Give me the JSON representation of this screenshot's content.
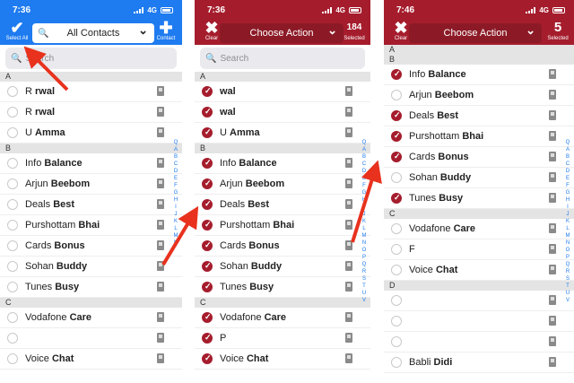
{
  "colors": {
    "blue": "#1e7bf0",
    "red": "#a51d2d",
    "redDark": "#8c1a26"
  },
  "panels": [
    {
      "id": "p1",
      "time": "7:36",
      "network": "4G",
      "left_glyph": "✔",
      "left_caption": "Select All",
      "center_label": "All Contacts",
      "right_glyph": "✚",
      "right_caption": "Contact",
      "search_placeholder": "Search",
      "index_letters": [
        "Q",
        "A",
        "B",
        "C",
        "D",
        "E",
        "F",
        "G",
        "H",
        "I",
        "J",
        "K",
        "L",
        "M",
        "N"
      ],
      "sections": [
        {
          "letter": "A",
          "rows": [
            {
              "first": "R",
              "last": "rwal",
              "checked": false,
              "icon": "phone"
            },
            {
              "first": "R",
              "last": "rwal",
              "checked": false,
              "icon": "phone"
            },
            {
              "first": "U",
              "last": "Amma",
              "checked": false,
              "icon": "phone"
            }
          ]
        },
        {
          "letter": "B",
          "rows": [
            {
              "first": "Info",
              "last": "Balance",
              "checked": false,
              "icon": "phone"
            },
            {
              "first": "Arjun",
              "last": "Beebom",
              "checked": false,
              "icon": "phone"
            },
            {
              "first": "Deals",
              "last": "Best",
              "checked": false,
              "icon": "phone"
            },
            {
              "first": "Purshottam",
              "last": "Bhai",
              "checked": false,
              "icon": "phone"
            },
            {
              "first": "Cards",
              "last": "Bonus",
              "checked": false,
              "icon": "phone"
            },
            {
              "first": "Sohan",
              "last": "Buddy",
              "checked": false,
              "icon": "phone"
            },
            {
              "first": "Tunes",
              "last": "Busy",
              "checked": false,
              "icon": "phone"
            }
          ]
        },
        {
          "letter": "C",
          "rows": [
            {
              "first": "Vodafone",
              "last": "Care",
              "checked": false,
              "icon": "phone"
            },
            {
              "first": "",
              "last": "",
              "checked": false,
              "icon": "phone"
            },
            {
              "first": "Voice",
              "last": "Chat",
              "checked": false,
              "icon": "phone"
            }
          ]
        }
      ]
    },
    {
      "id": "p2",
      "time": "7:36",
      "network": "4G",
      "left_glyph": "✖",
      "left_caption": "Clear",
      "center_label": "Choose Action",
      "right_glyph": "184",
      "right_caption": "Selected",
      "search_placeholder": "Search",
      "index_letters": [
        "Q",
        "A",
        "B",
        "C",
        "D",
        "E",
        "F",
        "G",
        "H",
        "I",
        "J",
        "K",
        "L",
        "M",
        "N",
        "O",
        "P",
        "Q",
        "R",
        "S",
        "T",
        "U",
        "V"
      ],
      "sections": [
        {
          "letter": "A",
          "rows": [
            {
              "first": "",
              "last": "wal",
              "checked": true,
              "icon": "phone"
            },
            {
              "first": "",
              "last": "wal",
              "checked": true,
              "icon": "phone"
            },
            {
              "first": "U",
              "last": "Amma",
              "checked": true,
              "icon": "phone"
            }
          ]
        },
        {
          "letter": "B",
          "rows": [
            {
              "first": "Info",
              "last": "Balance",
              "checked": true,
              "icon": "phone"
            },
            {
              "first": "Arjun",
              "last": "Beebom",
              "checked": true,
              "icon": "phone"
            },
            {
              "first": "Deals",
              "last": "Best",
              "checked": true,
              "icon": "phone"
            },
            {
              "first": "Purshottam",
              "last": "Bhai",
              "checked": true,
              "icon": "phone"
            },
            {
              "first": "Cards",
              "last": "Bonus",
              "checked": true,
              "icon": "phone"
            },
            {
              "first": "Sohan",
              "last": "Buddy",
              "checked": true,
              "icon": "phone"
            },
            {
              "first": "Tunes",
              "last": "Busy",
              "checked": true,
              "icon": "phone"
            }
          ]
        },
        {
          "letter": "C",
          "rows": [
            {
              "first": "Vodafone",
              "last": "Care",
              "checked": true,
              "icon": "phone"
            },
            {
              "first": "P",
              "last": "",
              "checked": true,
              "icon": "phone"
            },
            {
              "first": "Voice",
              "last": "Chat",
              "checked": true,
              "icon": "phone"
            }
          ]
        }
      ]
    },
    {
      "id": "p3",
      "time": "7:46",
      "network": "4G",
      "left_glyph": "✖",
      "left_caption": "Clear",
      "center_label": "Choose Action",
      "right_glyph": "5",
      "right_caption": "Selected",
      "search_placeholder": "",
      "index_letters": [
        "Q",
        "A",
        "B",
        "C",
        "D",
        "E",
        "F",
        "G",
        "H",
        "I",
        "J",
        "K",
        "L",
        "M",
        "N",
        "O",
        "P",
        "Q",
        "R",
        "S",
        "T",
        "U",
        "V"
      ],
      "sections": [
        {
          "letter": "A",
          "rows": []
        },
        {
          "letter": "B",
          "rows": [
            {
              "first": "Info",
              "last": "Balance",
              "checked": true,
              "icon": "phone"
            },
            {
              "first": "Arjun",
              "last": "Beebom",
              "checked": false,
              "icon": "phone"
            },
            {
              "first": "Deals",
              "last": "Best",
              "checked": true,
              "icon": "phone"
            },
            {
              "first": "Purshottam",
              "last": "Bhai",
              "checked": true,
              "icon": "phone"
            },
            {
              "first": "Cards",
              "last": "Bonus",
              "checked": true,
              "icon": "phone"
            },
            {
              "first": "Sohan",
              "last": "Buddy",
              "checked": false,
              "icon": "phone"
            },
            {
              "first": "Tunes",
              "last": "Busy",
              "checked": true,
              "icon": "phone"
            }
          ]
        },
        {
          "letter": "C",
          "rows": [
            {
              "first": "Vodafone",
              "last": "Care",
              "checked": false,
              "icon": "phone"
            },
            {
              "first": "F",
              "last": "",
              "checked": false,
              "icon": "phone"
            },
            {
              "first": "Voice",
              "last": "Chat",
              "checked": false,
              "icon": "phone"
            }
          ]
        },
        {
          "letter": "D",
          "rows": [
            {
              "first": "",
              "last": "",
              "checked": false,
              "icon": "phone"
            },
            {
              "first": "",
              "last": "",
              "checked": false,
              "icon": "phone"
            },
            {
              "first": "",
              "last": "",
              "checked": false,
              "icon": "phone"
            },
            {
              "first": "Babli",
              "last": "Didi",
              "checked": false,
              "icon": "phone"
            }
          ]
        }
      ]
    }
  ]
}
